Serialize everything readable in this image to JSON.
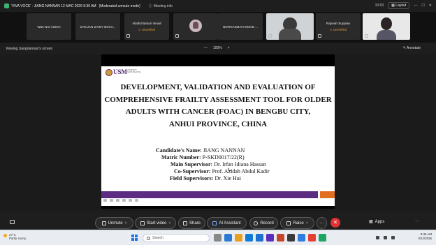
{
  "window": {
    "meeting_title": "'VIVA VOCE' - JIANG NANNAN 12 MAC 2026 9:30 AM",
    "moderation": "(Moderated unmute mode)",
    "meeting_info": "Meeting info",
    "time": "10:03",
    "layout_label": "Layout"
  },
  "participants": [
    {
      "name": "Wan Nor Azleen",
      "status": ""
    },
    {
      "name": "ZAKUAN ZAINY BIN D...",
      "status": ""
    },
    {
      "name": "shaiful Bahari Ismail",
      "status": "Unverified"
    },
    {
      "name": "",
      "status": ""
    },
    {
      "name": "NORHASMAH MOHD ...",
      "status": ""
    },
    {
      "name": "",
      "status": ""
    },
    {
      "name": "Rapeah Suppian",
      "status": "Unverified"
    },
    {
      "name": "",
      "status": ""
    }
  ],
  "viewbar": {
    "viewing": "Viewing Jiangnannan's screen",
    "zoom": "100%",
    "annotate": "Annotate"
  },
  "slide": {
    "logo_text": "USM",
    "logo_sub": "UNIVERSITI SAINS MALAYSIA",
    "title_lines": [
      "DEVELOPMENT, VALIDATION AND EVALUATION OF",
      "COMPREHENSIVE FRAILTY ASSESSMENT TOOL FOR OLDER",
      "ADULTS WITH CANCER (FOAC) IN BENGBU CITY,",
      "ANHUI PROVINCE, CHINA"
    ],
    "rows": [
      {
        "label": "Candidate's Name:",
        "value": "JIANG NANNAN"
      },
      {
        "label": "Matric Number:",
        "value": "P-SKD0017/22(R)"
      },
      {
        "label": "Main Supervisor:",
        "value": "Dr. Irfan Idiana Hassan"
      },
      {
        "label": "Co-Supervisor:",
        "value": "Prof. Azidah Abdul Kadir"
      },
      {
        "label": "Field Supervisors:",
        "value": "Dr. Xie Hui"
      }
    ]
  },
  "toolbar": {
    "unmute": "Unmute",
    "start_video": "Start video",
    "share": "Share",
    "ai_assistant": "AI Assistant",
    "record": "Record",
    "raise": "Raise",
    "apps": "Apps"
  },
  "taskbar": {
    "temp": "27°C",
    "weather": "Partly sunny",
    "search_placeholder": "Search",
    "clock_time": "9:46 AM",
    "clock_date": "3/12/2026"
  }
}
